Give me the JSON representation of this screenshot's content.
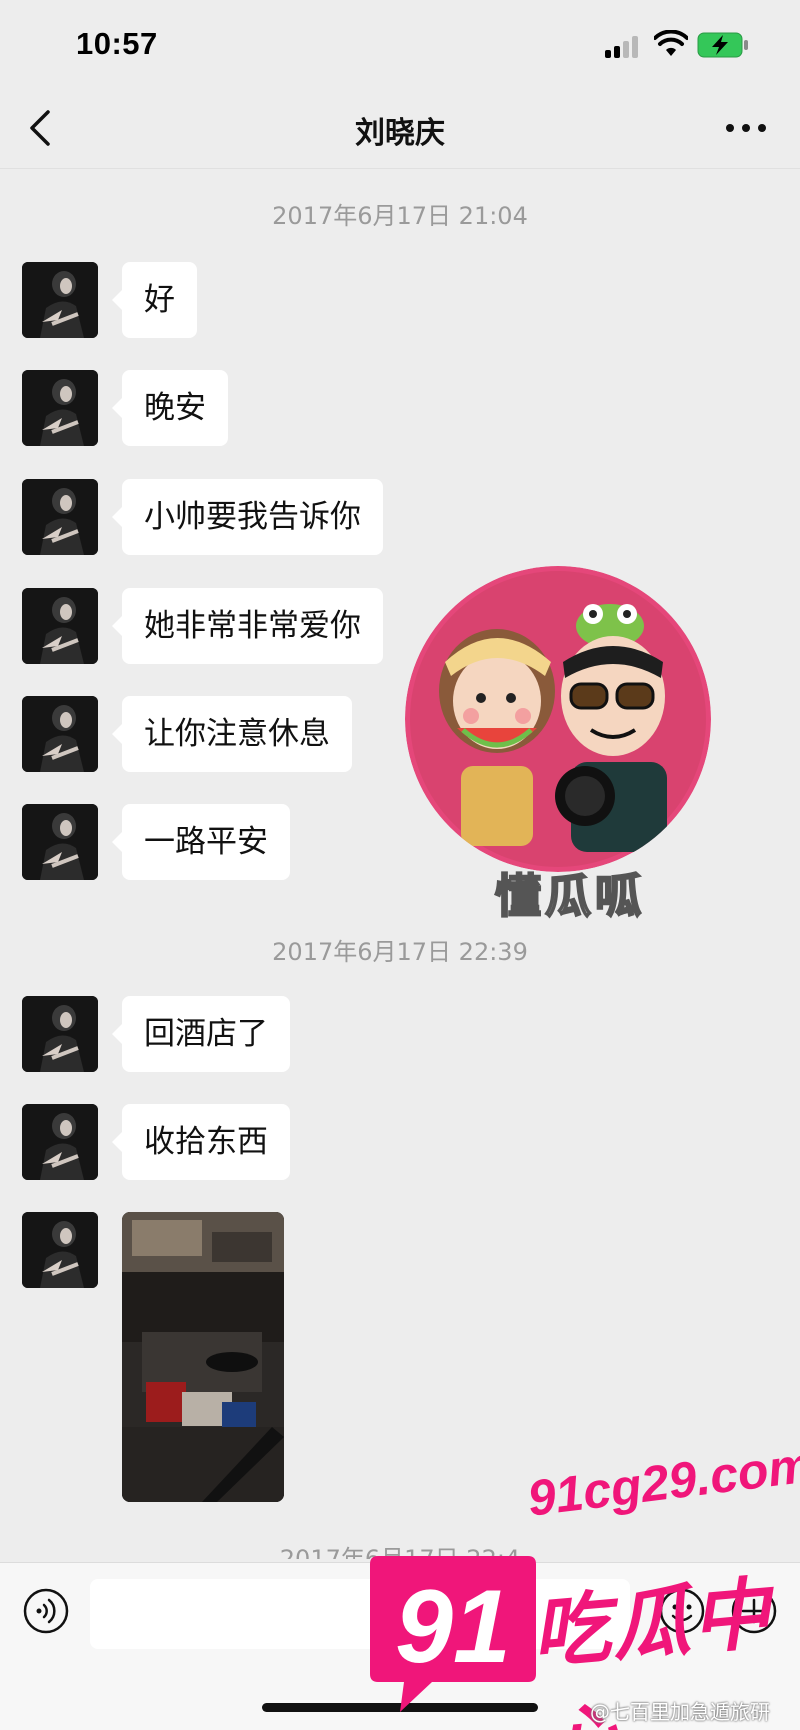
{
  "status_bar": {
    "time": "10:57",
    "signal_icon": "cellular-signal-icon",
    "wifi_icon": "wifi-icon",
    "battery_icon": "battery-charging-icon",
    "battery_color": "#34c759"
  },
  "header": {
    "back_icon": "chevron-left-icon",
    "title": "刘晓庆",
    "more_icon": "more-dots-icon"
  },
  "chat": {
    "timestamps": [
      "2017年6月17日 21:04",
      "2017年6月17日 22:39",
      "2017年6月17日 22:4"
    ],
    "messages": [
      {
        "type": "text",
        "text": "好"
      },
      {
        "type": "text",
        "text": "晚安"
      },
      {
        "type": "text",
        "text": "小帅要我告诉你"
      },
      {
        "type": "text",
        "text": "她非常非常爱你"
      },
      {
        "type": "text",
        "text": "让你注意休息"
      },
      {
        "type": "text",
        "text": "一路平安"
      },
      {
        "type": "text",
        "text": "回酒店了"
      },
      {
        "type": "text",
        "text": "收拾东西"
      },
      {
        "type": "image",
        "icon": "photo-thumbnail"
      }
    ]
  },
  "input_bar": {
    "voice_icon": "voice-icon",
    "text_value": "",
    "emoji_icon": "emoji-icon",
    "plus_icon": "plus-circle-icon"
  },
  "overlays": {
    "logo_caption": "懂瓜呱",
    "promo_badge": "91",
    "promo_url": "91cg29.com",
    "promo_text": "吃瓜中心",
    "credit": "@七百里加急遁旅研",
    "accent_color": "#f0167a"
  }
}
